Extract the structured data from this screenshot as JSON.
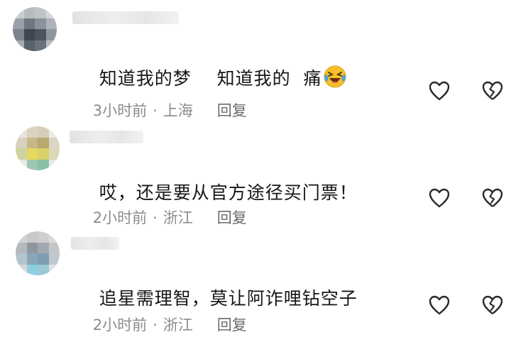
{
  "comments": [
    {
      "text": "知道我的梦    知道我的  痛",
      "emoji_icon": "grinning-squinting-tears-emoji",
      "time": "3小时前",
      "location": "上海",
      "reply_label": "回复"
    },
    {
      "text": "哎，还是要从官方途径买门票！",
      "time": "2小时前",
      "location": "浙江",
      "reply_label": "回复"
    },
    {
      "text": "追星需理智，莫让阿诈哩钻空子",
      "time": "2小时前",
      "location": "浙江",
      "reply_label": "回复"
    }
  ],
  "separator": "·",
  "icons": {
    "like": "heart-outline-icon",
    "dislike": "broken-heart-icon"
  },
  "colors": {
    "text": "#161616",
    "meta": "#8c8c8c",
    "icon": "#2a2a2a"
  }
}
